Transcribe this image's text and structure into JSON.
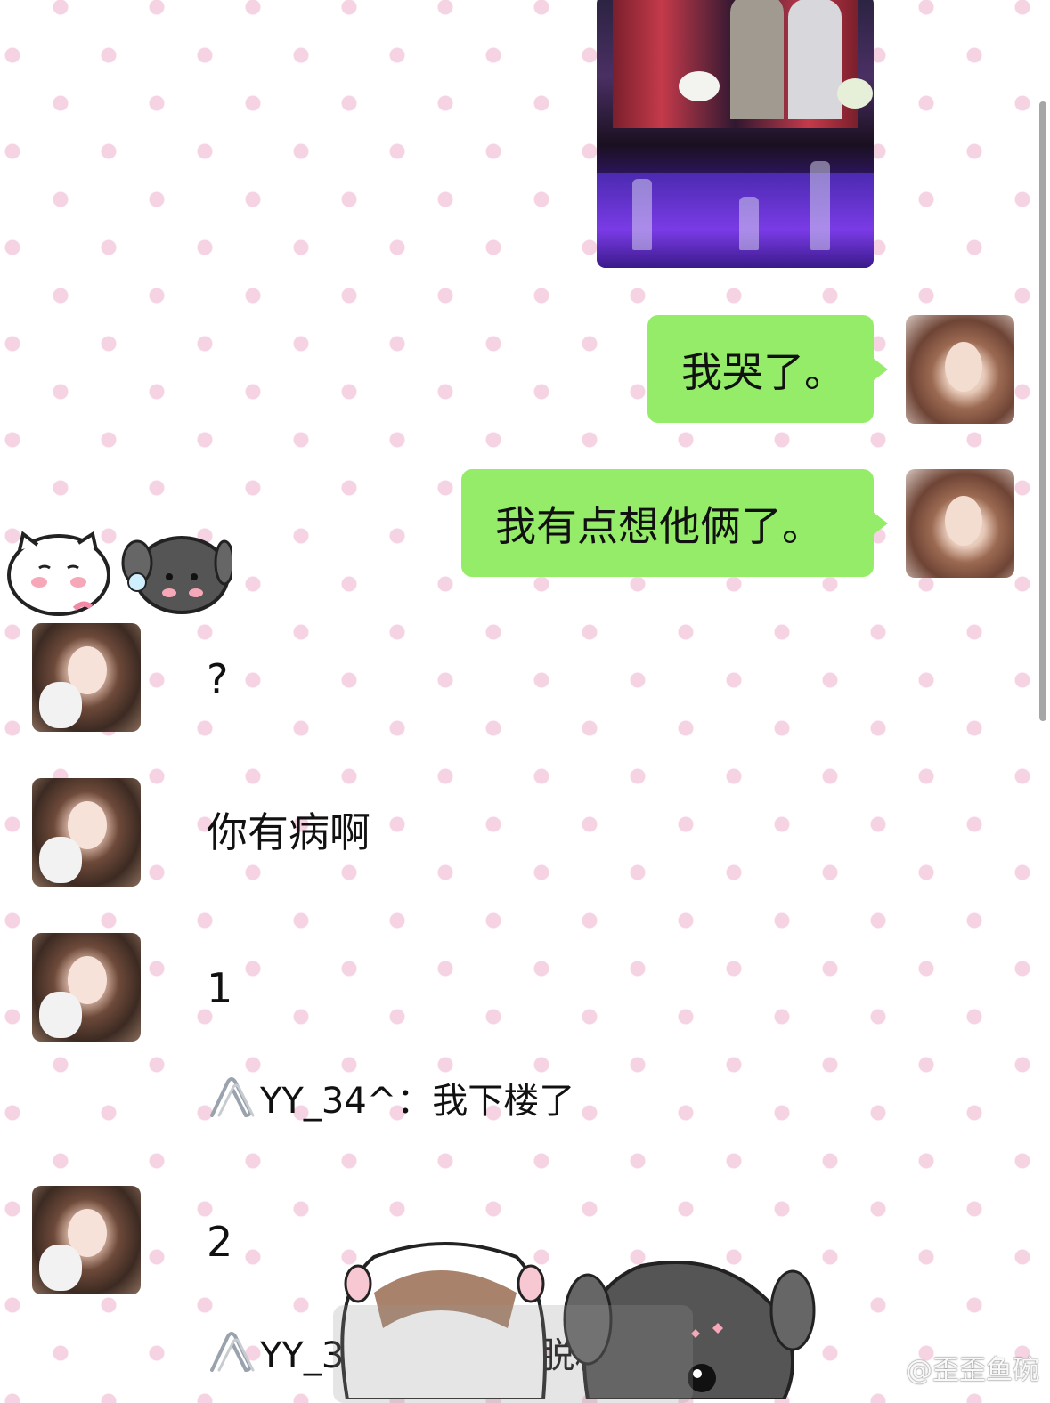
{
  "messages": [
    {
      "text": "我哭了。"
    },
    {
      "text": "我有点想他俩了。"
    },
    {
      "text": "?"
    },
    {
      "text": "你有病啊"
    },
    {
      "text": "1"
    },
    {
      "text": "2"
    }
  ],
  "quotes": [
    {
      "text": "YY_34^：我下楼了"
    },
    {
      "text": "YY_34^：我已经脱粉了"
    }
  ],
  "watermark": {
    "text": "@歪歪鱼碗"
  },
  "colors": {
    "bubble_green": "#95ec69",
    "polka_dot": "#f6d3e2",
    "background": "#ffffff"
  },
  "icons": {
    "quote": "paperclip-icon",
    "watermark": "weibo-logo-icon"
  }
}
